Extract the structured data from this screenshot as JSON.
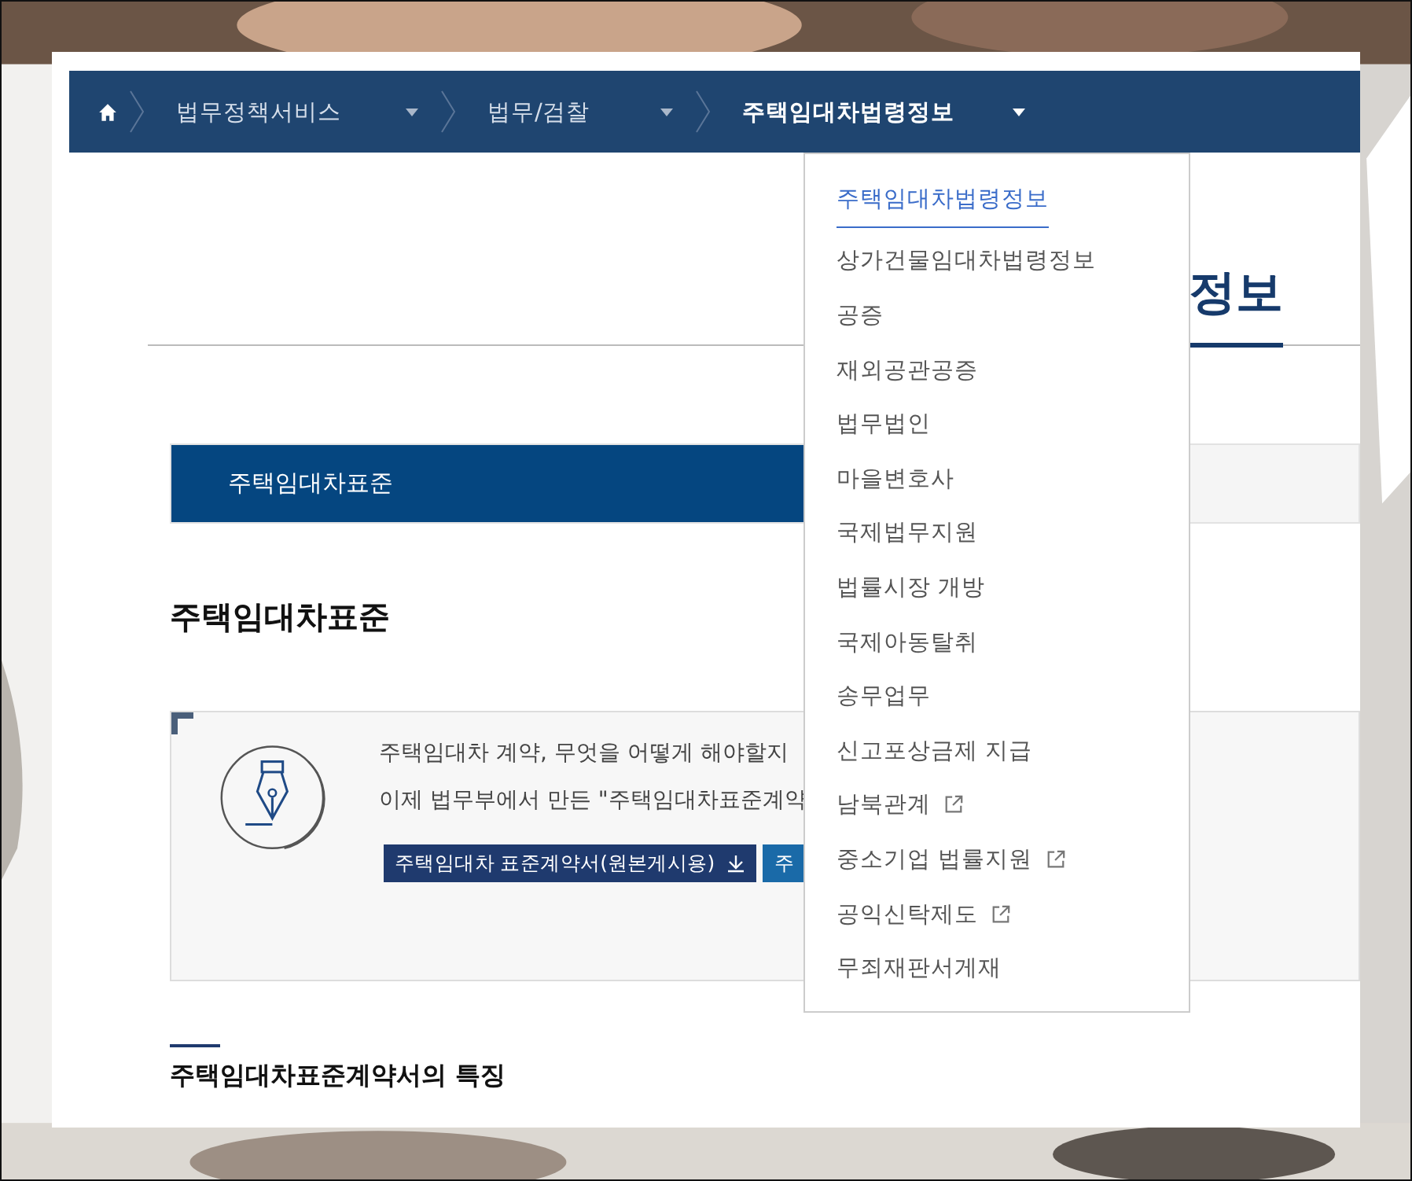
{
  "breadcrumb": [
    {
      "label": "법무정책서비스",
      "current": false
    },
    {
      "label": "법무/검찰",
      "current": false
    },
    {
      "label": "주택임대차법령정보",
      "current": true
    }
  ],
  "dropdown": {
    "items": [
      {
        "label": "주택임대차법령정보",
        "selected": true,
        "external": false
      },
      {
        "label": "상가건물임대차법령정보",
        "selected": false,
        "external": false
      },
      {
        "label": "공증",
        "selected": false,
        "external": false
      },
      {
        "label": "재외공관공증",
        "selected": false,
        "external": false
      },
      {
        "label": "법무법인",
        "selected": false,
        "external": false
      },
      {
        "label": "마을변호사",
        "selected": false,
        "external": false
      },
      {
        "label": "국제법무지원",
        "selected": false,
        "external": false
      },
      {
        "label": "법률시장 개방",
        "selected": false,
        "external": false
      },
      {
        "label": "국제아동탈취",
        "selected": false,
        "external": false
      },
      {
        "label": "송무업무",
        "selected": false,
        "external": false
      },
      {
        "label": "신고포상금제 지급",
        "selected": false,
        "external": false
      },
      {
        "label": "남북관계",
        "selected": false,
        "external": true
      },
      {
        "label": "중소기업 법률지원",
        "selected": false,
        "external": true
      },
      {
        "label": "공익신탁제도",
        "selected": false,
        "external": true
      },
      {
        "label": "무죄재판서게재",
        "selected": false,
        "external": false
      }
    ]
  },
  "page_title": "정보",
  "tabs": [
    {
      "label": "주택임대차표준",
      "selected": true
    }
  ],
  "section_title": "주택임대차표준",
  "intro": {
    "lines": [
      "주택임대차 계약, 무엇을 어떻게 해야할지",
      "이제 법무부에서 만든 \"주택임대차표준계약"
    ],
    "buttons": [
      {
        "label": "주택임대차 표준계약서(원본게시용)",
        "kind": "download"
      },
      {
        "label": "주",
        "kind": "plain"
      }
    ]
  },
  "subsection_title": "주택임대차표준계약서의 특징"
}
